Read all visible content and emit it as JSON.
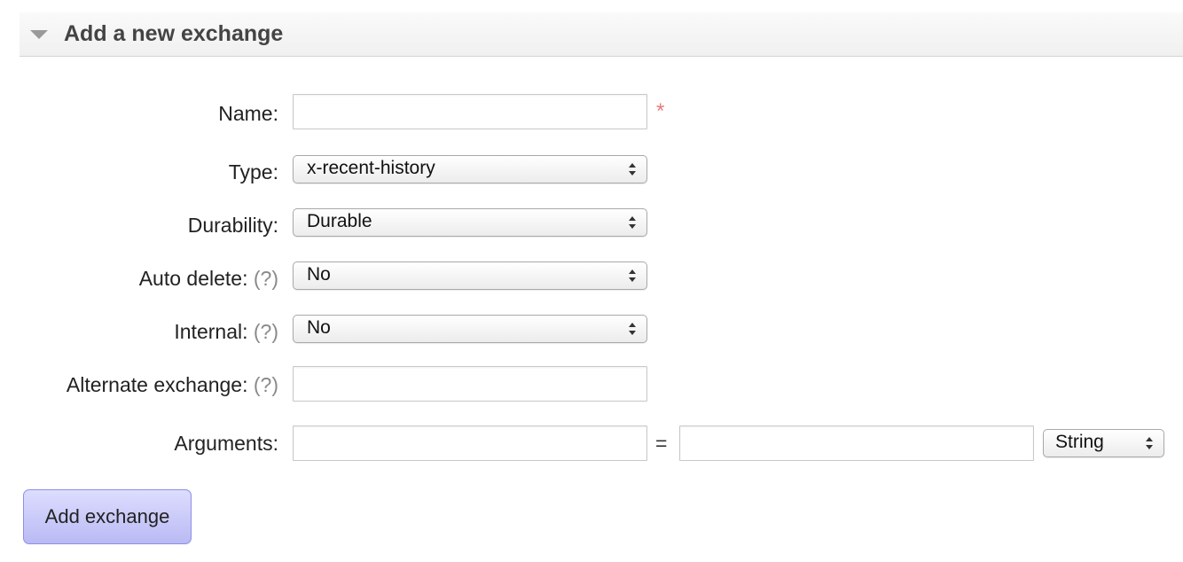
{
  "section": {
    "title": "Add a new exchange"
  },
  "form": {
    "name_label": "Name:",
    "name_value": "",
    "required_mark": "*",
    "type_label": "Type:",
    "type_value": "x-recent-history",
    "durability_label": "Durability:",
    "durability_value": "Durable",
    "auto_delete_label": "Auto delete:",
    "auto_delete_value": "No",
    "internal_label": "Internal:",
    "internal_value": "No",
    "alternate_exchange_label": "Alternate exchange:",
    "alternate_exchange_value": "",
    "help_text": "(?)",
    "arguments_label": "Arguments:",
    "arguments_key_value": "",
    "equals": "=",
    "arguments_value_value": "",
    "arguments_type_value": "String"
  },
  "actions": {
    "add_label": "Add exchange"
  },
  "colors": {
    "required": "#e87a7a",
    "button_bg": "#c8c8f8",
    "button_border": "#8f8fe6",
    "help": "#8a8a8a"
  },
  "icons": {
    "collapse": "triangle-down",
    "select": "up-down-arrows"
  }
}
